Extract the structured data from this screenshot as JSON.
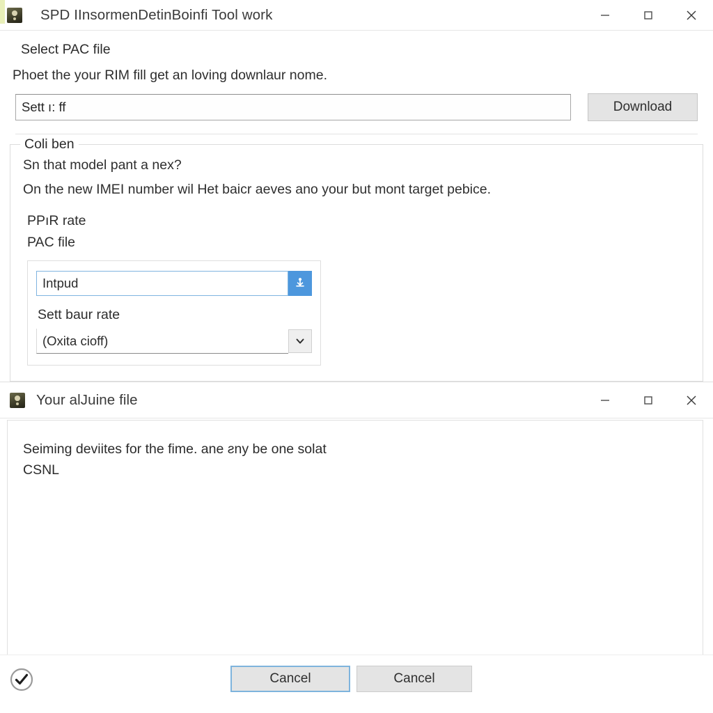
{
  "window1": {
    "title": "SPD IInsormenDetinBoinfi Tool work",
    "icon": "app-icon",
    "controls": {
      "minimize": "minimize-icon",
      "maximize": "maximize-icon",
      "close": "close-icon"
    },
    "select_pac": {
      "heading": "Select PAC file",
      "description": "Phoet the your RIM fill get an loving downlaur nome.",
      "path_value": "Sett ı: ff",
      "path_placeholder": "",
      "download_label": "Download"
    },
    "group": {
      "legend": "Coli ben",
      "line1": "Sn that model pant a nex?",
      "line2": "On the new IMEI number wil Het baicr aeves ano your but mont target pebice.",
      "label_ppir": "PPıR rate",
      "label_pac": "PAC file",
      "input_value": "Intpud",
      "input_placeholder": "",
      "download_icon": "download-tray-icon",
      "baud_label": "Sett baur rate",
      "combo_value": "(Oxita cioff)",
      "combo_arrow_icon": "chevron-down-icon",
      "combo_options": [
        "(Oxita cioff)"
      ]
    }
  },
  "window2": {
    "title": "Your alJuine file",
    "icon": "app-icon",
    "controls": {
      "minimize": "minimize-icon",
      "maximize": "maximize-icon",
      "close": "close-icon"
    },
    "body_line1": "Seiming deviites for the fime. ane ƨny be one solat",
    "body_line2": "CSNL",
    "footer": {
      "status_icon": "check-circle-icon",
      "primary_button": "Cancel",
      "secondary_button": "Cancel"
    }
  },
  "colors": {
    "accent_blue": "#4d97dd",
    "focus_blue": "#7eb4dd",
    "button_face": "#e4e4e4",
    "title_accent": "#e8efb8"
  }
}
